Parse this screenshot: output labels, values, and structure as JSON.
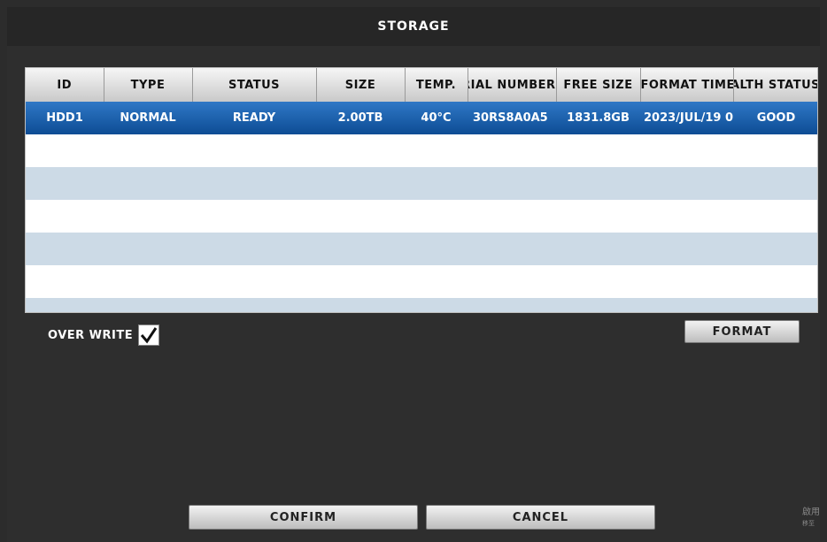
{
  "dialog": {
    "title": "STORAGE"
  },
  "table": {
    "headers": [
      "ID",
      "TYPE",
      "STATUS",
      "SIZE",
      "TEMP.",
      "SERIAL NUMBER",
      "FREE SIZE",
      "FORMAT TIME",
      "HEALTH STATUS"
    ],
    "rows": [
      [
        "HDD1",
        "NORMAL",
        "READY",
        "2.00TB",
        "40°C",
        "30RS8A0A5",
        "1831.8GB",
        "2023/JUL/19 0",
        "GOOD"
      ],
      [
        "",
        "",
        "",
        "",
        "",
        "",
        "",
        "",
        ""
      ],
      [
        "",
        "",
        "",
        "",
        "",
        "",
        "",
        "",
        ""
      ],
      [
        "",
        "",
        "",
        "",
        "",
        "",
        "",
        "",
        ""
      ],
      [
        "",
        "",
        "",
        "",
        "",
        "",
        "",
        "",
        ""
      ],
      [
        "",
        "",
        "",
        "",
        "",
        "",
        "",
        "",
        ""
      ]
    ]
  },
  "options": {
    "overwrite_label": "OVER WRITE",
    "overwrite_checked": true
  },
  "buttons": {
    "format": "FORMAT",
    "confirm": "CONFIRM",
    "cancel": "CANCEL"
  },
  "watermark": {
    "line1": "啟用",
    "line2": "移至"
  },
  "colors": {
    "selected_row": "#1a5fae",
    "alt_row": "#ccdae6",
    "background": "#2c2c2c"
  }
}
